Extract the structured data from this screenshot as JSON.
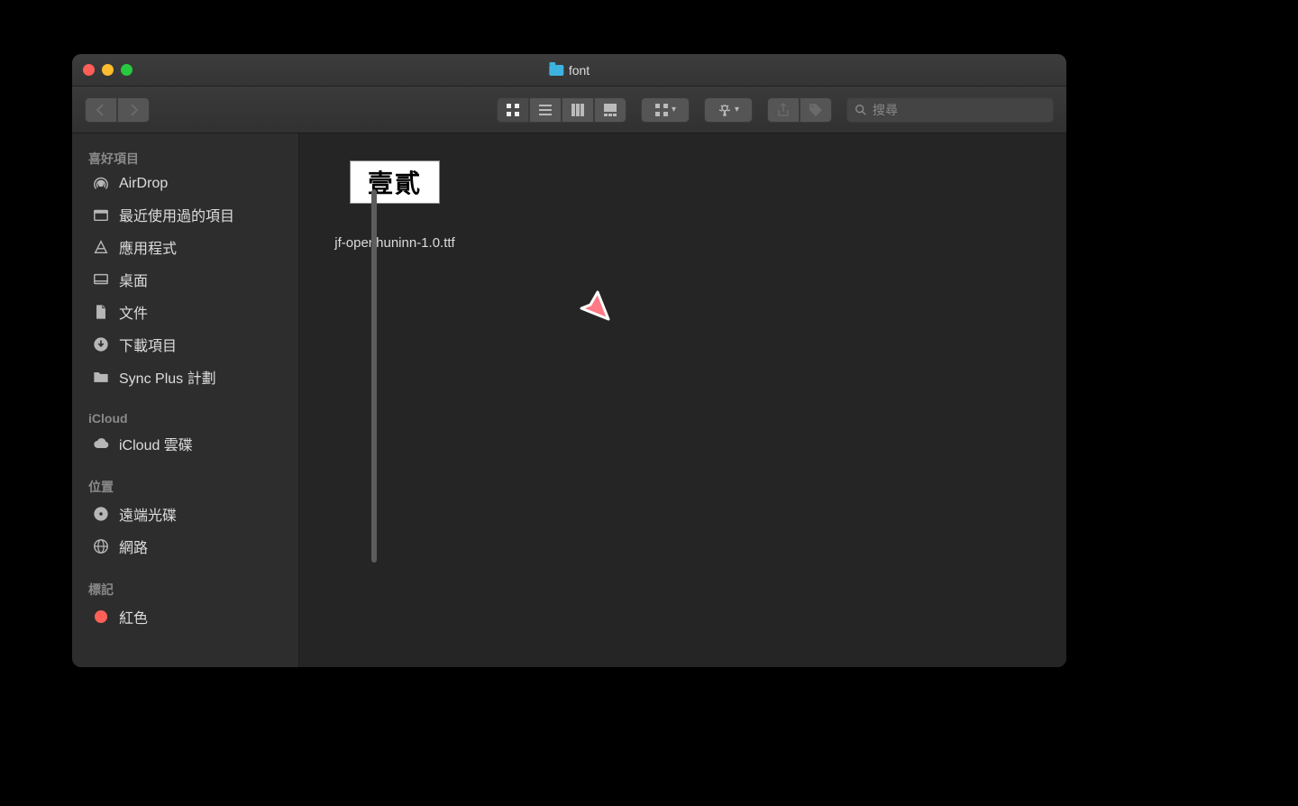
{
  "window": {
    "title": "font",
    "traffic": [
      "close",
      "minimize",
      "zoom"
    ]
  },
  "toolbar": {
    "back": "‹",
    "forward": "›",
    "views": [
      "icon",
      "list",
      "column",
      "gallery"
    ],
    "arrange_label": "",
    "action_label": "",
    "search_placeholder": "搜尋"
  },
  "sidebar": {
    "sections": [
      {
        "header": "喜好項目",
        "items": [
          {
            "icon": "airdrop",
            "label": "AirDrop"
          },
          {
            "icon": "recents",
            "label": "最近使用過的項目"
          },
          {
            "icon": "apps",
            "label": "應用程式"
          },
          {
            "icon": "desktop",
            "label": "桌面"
          },
          {
            "icon": "documents",
            "label": "文件"
          },
          {
            "icon": "downloads",
            "label": "下載項目"
          },
          {
            "icon": "folder",
            "label": "Sync Plus 計劃"
          }
        ]
      },
      {
        "header": "iCloud",
        "items": [
          {
            "icon": "cloud",
            "label": "iCloud 雲碟"
          }
        ]
      },
      {
        "header": "位置",
        "items": [
          {
            "icon": "disc",
            "label": "遠端光碟"
          },
          {
            "icon": "network",
            "label": "網路"
          }
        ]
      },
      {
        "header": "標記",
        "items": [
          {
            "icon": "tag",
            "color": "#ff6159",
            "label": "紅色"
          }
        ]
      }
    ]
  },
  "files": [
    {
      "name": "jf-openhuninn-1.0.ttf",
      "preview": "壹貳"
    }
  ],
  "cursor_color": "#ff7a85"
}
